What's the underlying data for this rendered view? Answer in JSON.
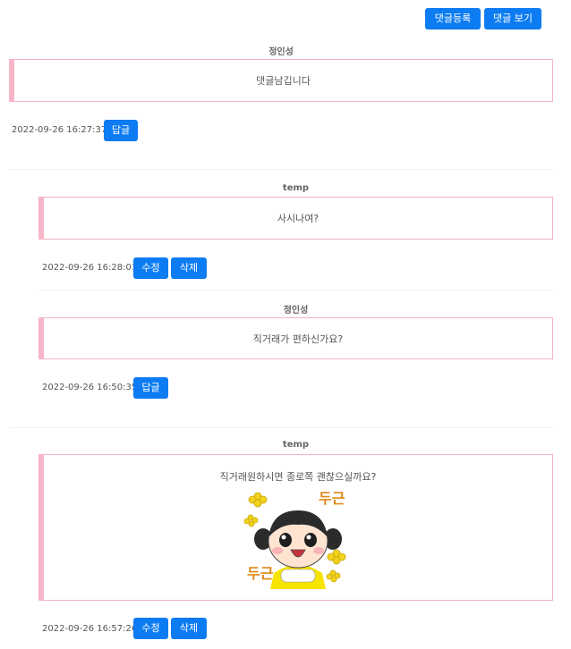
{
  "toolbar": {
    "register_label": "댓글등록",
    "view_label": "댓글 보기"
  },
  "comments": [
    {
      "author": "정인성",
      "text": "댓글남깁니다",
      "timestamp": "2022-09-26 16:27:37",
      "buttons": [
        "답글"
      ]
    },
    {
      "author": "temp",
      "text": "사시나여?",
      "timestamp": "2022-09-26 16:28:01",
      "buttons": [
        "수정",
        "삭제"
      ]
    },
    {
      "author": "정인성",
      "text": "직거래가 편하신가요?",
      "timestamp": "2022-09-26 16:50:35",
      "buttons": [
        "답글"
      ]
    },
    {
      "author": "temp",
      "text": "직거래원하시면 종로쪽 괜찮으실까요?",
      "timestamp": "2022-09-26 16:57:26",
      "buttons": [
        "수정",
        "삭제"
      ]
    }
  ],
  "sticker": {
    "caption_top": "두근",
    "caption_bottom": "두근"
  },
  "colors": {
    "button": "#0d7cf2",
    "border": "#f3b3c5",
    "accent": "#f7b6c8"
  }
}
